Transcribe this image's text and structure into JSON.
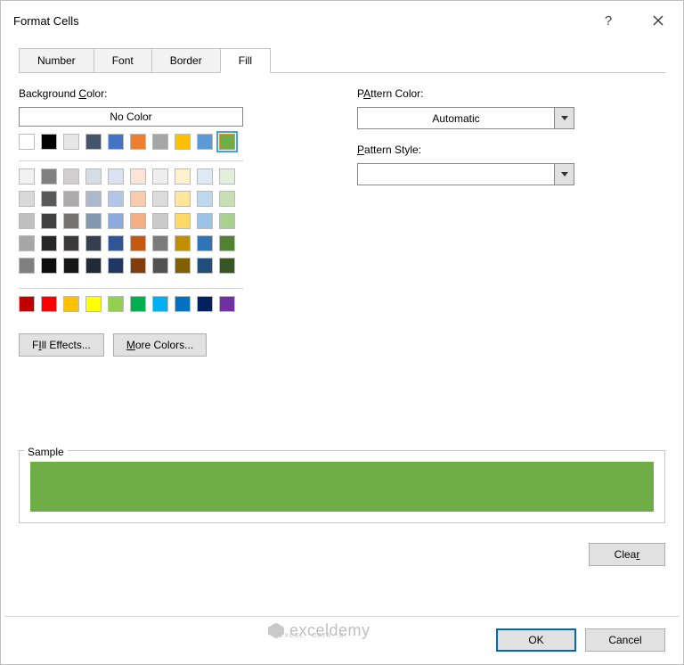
{
  "title": "Format Cells",
  "tabs": [
    "Number",
    "Font",
    "Border",
    "Fill"
  ],
  "activeTab": 3,
  "labels": {
    "bgColor": "Background Color:",
    "bgColor_u": "C",
    "noColor": "No Color",
    "patternColor": "Pattern Color:",
    "patternColor_u": "A",
    "patternStyle": "Pattern Style:",
    "patternStyle_u": "P",
    "fillEffects": "Fill Effects...",
    "fillEffects_u": "I",
    "moreColors": "More Colors...",
    "moreColors_u": "M",
    "sample": "Sample",
    "clear": "Clear",
    "clear_u": "r",
    "ok": "OK",
    "cancel": "Cancel"
  },
  "patternColor": {
    "value": "Automatic"
  },
  "patternStyle": {
    "value": ""
  },
  "selectedColor": "#70ad47",
  "themeRow1": [
    "#ffffff",
    "#000000",
    "#e7e6e6",
    "#44546a",
    "#4472c4",
    "#ed7d31",
    "#a5a5a5",
    "#ffc000",
    "#5b9bd5",
    "#70ad47"
  ],
  "themeGrid": [
    [
      "#f2f2f2",
      "#808080",
      "#d0cece",
      "#d6dce4",
      "#d9e1f2",
      "#fce4d6",
      "#ededed",
      "#fff2cc",
      "#ddebf7",
      "#e2efda"
    ],
    [
      "#d9d9d9",
      "#595959",
      "#aeaaaa",
      "#acb9ca",
      "#b4c6e7",
      "#f8cbad",
      "#dbdbdb",
      "#ffe699",
      "#bdd7ee",
      "#c6e0b4"
    ],
    [
      "#bfbfbf",
      "#404040",
      "#767171",
      "#8497b0",
      "#8ea9db",
      "#f4b084",
      "#c9c9c9",
      "#ffd966",
      "#9bc2e6",
      "#a9d08e"
    ],
    [
      "#a6a6a6",
      "#262626",
      "#3a3838",
      "#333f4f",
      "#305496",
      "#c65911",
      "#7b7b7b",
      "#bf8f00",
      "#2f75b5",
      "#548235"
    ],
    [
      "#808080",
      "#0d0d0d",
      "#161616",
      "#222b35",
      "#203764",
      "#833c0c",
      "#525252",
      "#806000",
      "#1f4e78",
      "#375623"
    ]
  ],
  "standardColors": [
    "#c00000",
    "#ff0000",
    "#ffc000",
    "#ffff00",
    "#92d050",
    "#00b050",
    "#00b0f0",
    "#0070c0",
    "#002060",
    "#7030a0"
  ],
  "watermark": {
    "main": "exceldemy",
    "sub": "EXCEL · DATA · BI"
  }
}
